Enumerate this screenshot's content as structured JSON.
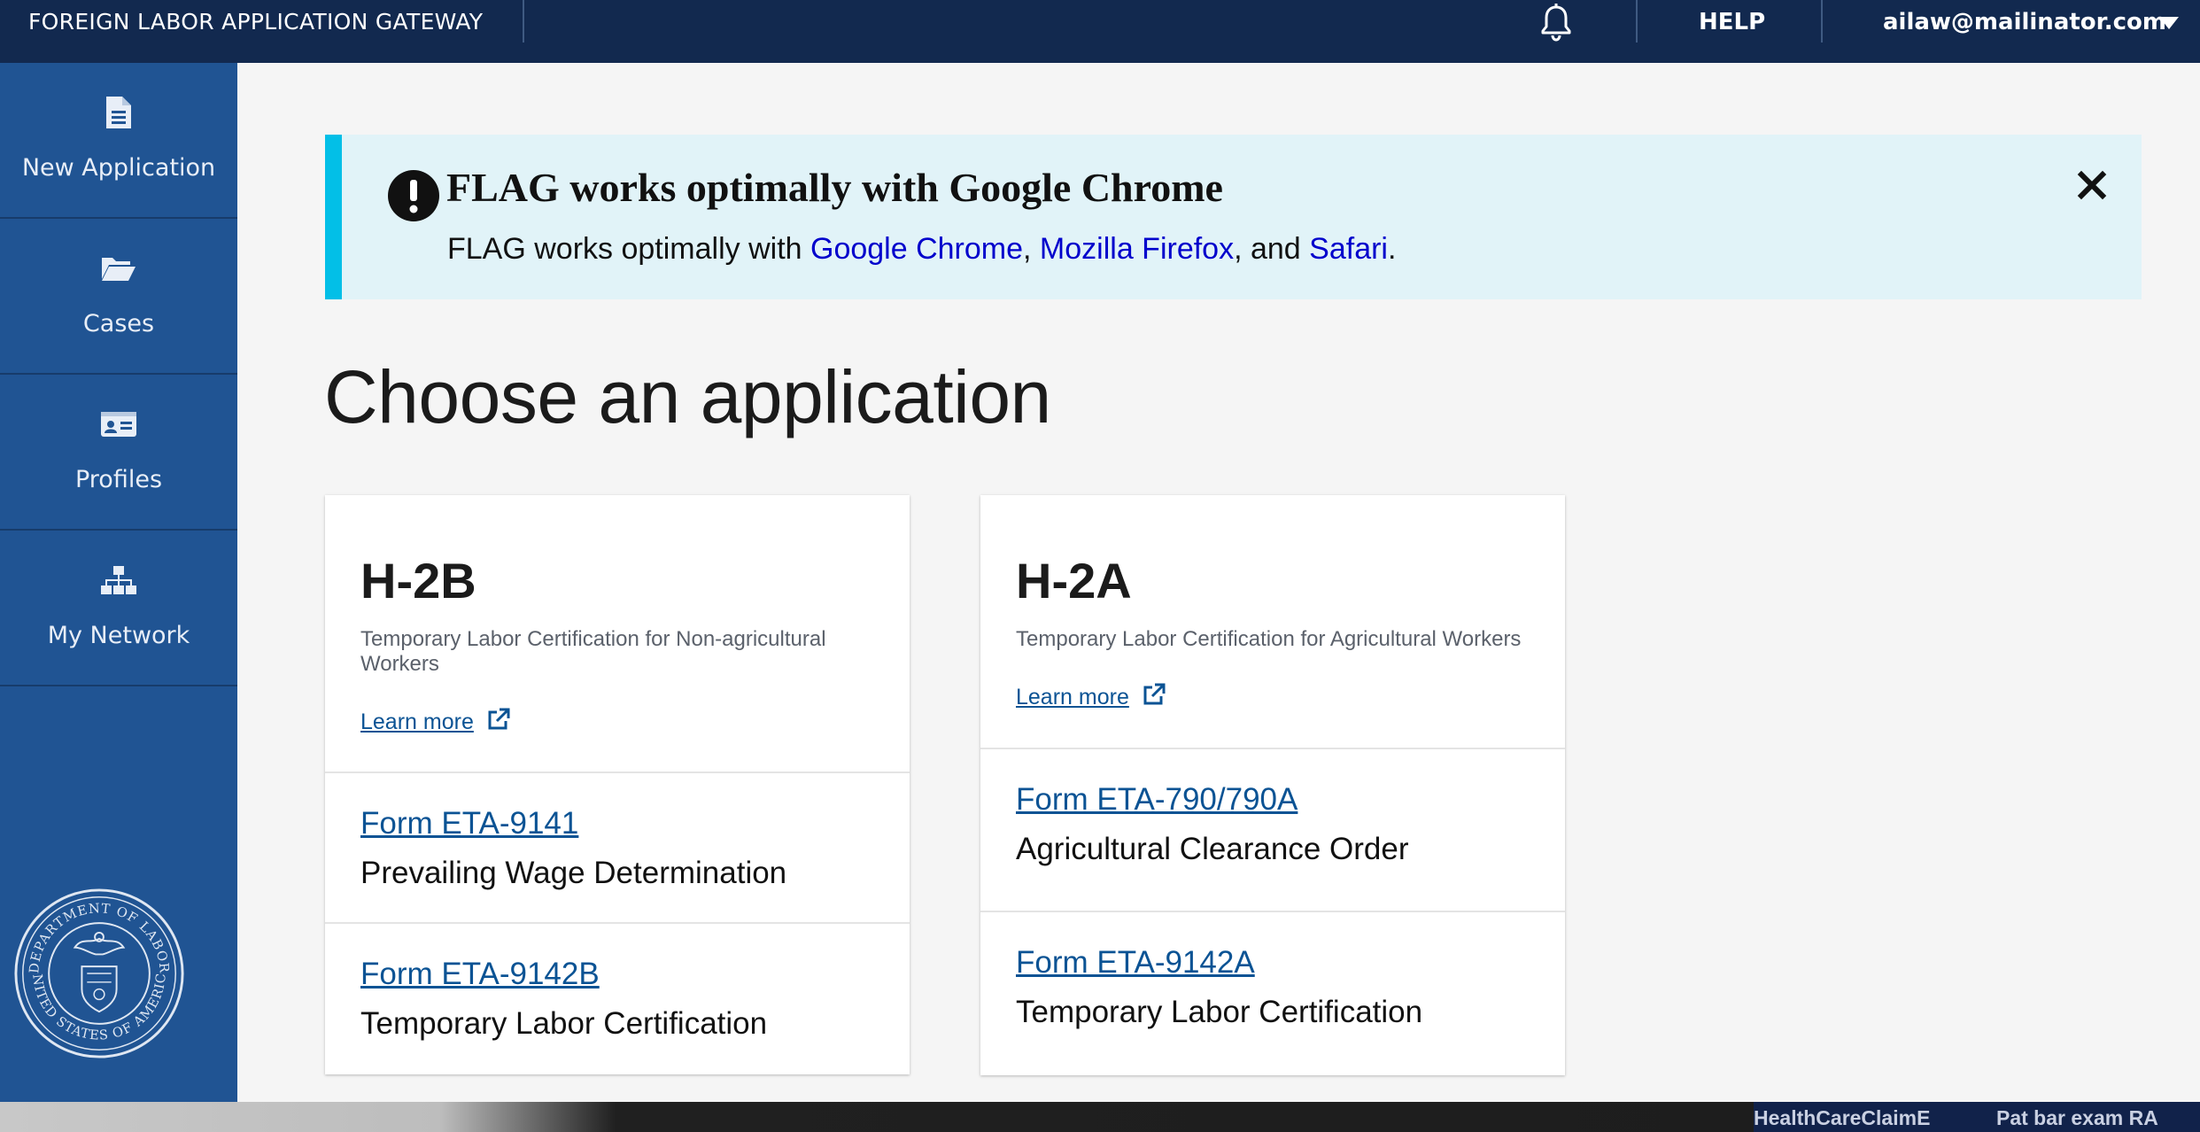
{
  "header": {
    "app_title": "FOREIGN LABOR APPLICATION GATEWAY",
    "help_label": "HELP",
    "user_email": "ailaw@mailinator.com",
    "bell_icon": "bell-icon",
    "caret_icon": "caret-down-icon"
  },
  "sidebar": {
    "items": [
      {
        "label": "New Application",
        "icon": "document-icon"
      },
      {
        "label": "Cases",
        "icon": "folder-open-icon"
      },
      {
        "label": "Profiles",
        "icon": "id-card-icon"
      },
      {
        "label": "My Network",
        "icon": "sitemap-icon"
      }
    ],
    "seal": {
      "icon": "department-of-labor-seal",
      "text_top": "DEPARTMENT OF LABOR",
      "text_bottom": "UNITED STATES OF AMERICA"
    }
  },
  "banner": {
    "heading": "FLAG works optimally with Google Chrome",
    "text_prefix": "FLAG works optimally with ",
    "link_chrome": "Google Chrome",
    "sep1": ", ",
    "link_firefox": "Mozilla Firefox",
    "sep2": ", and ",
    "link_safari": "Safari",
    "text_suffix": ".",
    "icon": "exclamation-circle-icon",
    "close_icon": "close-icon"
  },
  "main": {
    "title": "Choose an application",
    "cards": [
      {
        "heading": "H-2B",
        "description": "Temporary Labor Certification for Non-agricultural Workers",
        "learn_more": "Learn more",
        "forms": [
          {
            "link": "Form ETA-9141",
            "description": "Prevailing Wage Determination"
          },
          {
            "link": "Form ETA-9142B",
            "description": "Temporary Labor Certification"
          }
        ]
      },
      {
        "heading": "H-2A",
        "description": "Temporary Labor Certification for Agricultural Workers",
        "learn_more": "Learn more",
        "forms": [
          {
            "link": "Form ETA-790/790A",
            "description": "Agricultural Clearance Order"
          },
          {
            "link": "Form ETA-9142A",
            "description": "Temporary Labor Certification"
          }
        ]
      }
    ]
  },
  "taskbar": {
    "items": [
      "HealthCareClaimE",
      "Pat bar exam RA"
    ]
  },
  "colors": {
    "header_bg": "#12294f",
    "sidebar_bg": "#205493",
    "banner_bg": "#e1f3f8",
    "banner_accent": "#02bfe7",
    "link": "#0b5394"
  }
}
